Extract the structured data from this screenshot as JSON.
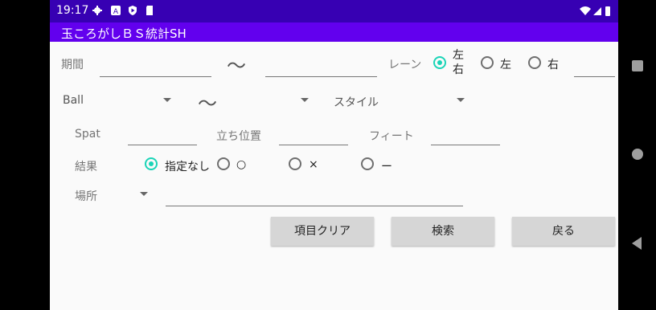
{
  "status_bar": {
    "time": "19:17",
    "icons": [
      "gear-icon",
      "a-icon",
      "play-protect-icon",
      "sd-card-icon",
      "wifi-icon",
      "signal-icon",
      "battery-icon"
    ]
  },
  "app_bar": {
    "title": "玉ころがしＢＳ統計SH"
  },
  "form": {
    "period_label": "期間",
    "period_tilde": "〜",
    "lane_label": "レーン",
    "lane_options": [
      "左\n右",
      "左",
      "右"
    ],
    "lane_selected": "左\n右",
    "ball_label": "Ball",
    "ball_tilde": "〜",
    "style_label": "スタイル",
    "spat_label": "Spat",
    "stand_label": "立ち位置",
    "feet_label": "フィート",
    "result_label": "結果",
    "result_options": [
      "指定なし",
      "○",
      "×",
      "ー"
    ],
    "result_selected": "指定なし",
    "place_label": "場所"
  },
  "buttons": {
    "clear": "項目クリア",
    "search": "検索",
    "back": "戻る"
  },
  "colors": {
    "status_bar": "#3700b3",
    "app_bar": "#6200ee",
    "radio_accent": "#1ad4b7",
    "button": "#d6d6d6"
  }
}
